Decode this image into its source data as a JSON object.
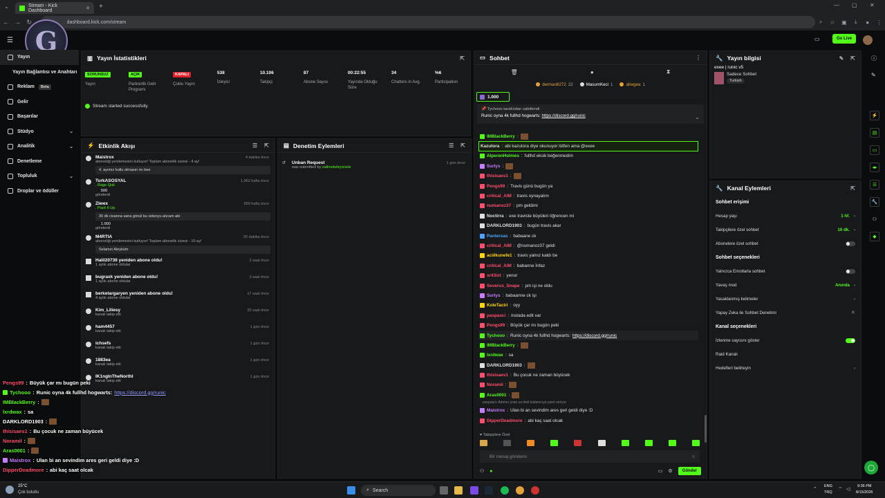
{
  "browser": {
    "tab_title": "Stream - Kick Dashboard",
    "url": "dashboard.kick.com/stream"
  },
  "header": {
    "go_live": "Go Live"
  },
  "sidebar": {
    "items": [
      {
        "label": "Yayın",
        "chev": false
      },
      {
        "label": "Yayın Bağlantısı ve Anahtarı",
        "chev": false
      },
      {
        "label": "Reklam",
        "badge": "Beta",
        "chev": false
      },
      {
        "label": "Gelir",
        "chev": false
      },
      {
        "label": "Başarılar",
        "chev": false
      },
      {
        "label": "Stüdyo",
        "chev": true
      },
      {
        "label": "Analitik",
        "chev": true
      },
      {
        "label": "Denetleme",
        "chev": false
      },
      {
        "label": "Topluluk",
        "chev": true
      },
      {
        "label": "Droplar ve ödüller",
        "chev": false
      }
    ]
  },
  "stats": {
    "title": "Yayın İstatistikleri",
    "status_msg": "Stream started successfully.",
    "items": [
      {
        "value": "SORUNSUZ",
        "label": "Yayın",
        "pill": "green"
      },
      {
        "value": "AÇIK",
        "label": "Partnerlik Gelir Programı",
        "pill": "green"
      },
      {
        "value": "KAPALI",
        "label": "Çoklu Yayın",
        "pill": "red"
      },
      {
        "value": "538",
        "label": "İzleyici"
      },
      {
        "value": "10.106",
        "label": "Takipçi"
      },
      {
        "value": "87",
        "label": "Abone Sayısı"
      },
      {
        "value": "00:22:55",
        "label": "Yayında Olduğu Süre"
      },
      {
        "value": "34",
        "label": "Chatters in Avg."
      },
      {
        "value": "%6",
        "label": "Participation"
      }
    ]
  },
  "activity": {
    "title": "Etkinlik Akışı",
    "rows": [
      {
        "name": "Maistrox",
        "desc": "aboneliği yenilemesini kutluyor! Toplam abonelik süresi - 4 ay!",
        "time": "4 dakika önce",
        "box": "4. ayımız kutlu olmasın mı bee"
      },
      {
        "name": "TurkASOSYAL",
        "desc": ". Rage Quit",
        "extra": "500",
        "extra2": "gönderdi",
        "time": "1,962 hafta önce"
      },
      {
        "name": "Ziwex",
        "desc": ". Pack It Up",
        "time": "969 hafta önce",
        "box": "30 dk civanna sana gönül bu videoyu atıcam abi",
        "extra": "1.000",
        "extra2": "gönderdi"
      },
      {
        "name": "M4RTIA",
        "desc": "aboneliği yenilemesini kutluyor! Toplam abonelik süresi - 10 ay!",
        "time": "20 dakika önce",
        "box": "Selamın Aleyküm"
      },
      {
        "name": "Halil20739 yeniden abone oldu!",
        "desc": "1 aylık abone oldular",
        "time": "2 saat önce"
      },
      {
        "name": "bugraxk yeniden abone oldu!",
        "desc": "1 aylık abone oldular",
        "time": "3 saat önce"
      },
      {
        "name": "berketargaryen yeniden abone oldu!",
        "desc": "4 aylık abone oldular",
        "time": "17 saat önce"
      },
      {
        "name": "Kim_Liliesy",
        "desc": "kanalı takip etti",
        "time": "20 saat önce"
      },
      {
        "name": "ham4457",
        "desc": "kanalı takip etti",
        "time": "1 gün önce"
      },
      {
        "name": "ichsefs",
        "desc": "kanalı takip etti",
        "time": "1 gün önce"
      },
      {
        "name": "1883ea",
        "desc": "kanalı takip etti",
        "time": "1 gün önce"
      },
      {
        "name": "IK1ngInTheNorthI",
        "desc": "kanalı takip etti",
        "time": "1 gün önce"
      }
    ]
  },
  "moderation": {
    "title": "Denetim Eylemleri",
    "rows": [
      {
        "name": "Unban Request",
        "desc": "was submitted by",
        "user": "zalimotizleyicisiiz",
        "time": "1 gün önce"
      }
    ]
  },
  "chat": {
    "title": "Sohbet",
    "top_gifters": [
      {
        "name": "derman8272",
        "count": "22"
      },
      {
        "name": "MasumKeci",
        "count": "1"
      },
      {
        "name": "aliwgea",
        "count": "1"
      }
    ],
    "kicks": "1.000",
    "pinned_by": "Tychooo tarafından sabitlendi",
    "pinned_text": "Runic oyna 4k fullhd hogwarts:",
    "pinned_link": "https://discord.gg/runic",
    "messages": [
      {
        "user": "IMBlackBerry",
        "color": "#53fc18",
        "text": "",
        "emote": true
      },
      {
        "user": "Kazutora",
        "color": "#e0e0e0",
        "text": "abi kazutora diye okunuyor lütfen ama @exee",
        "highlight": true
      },
      {
        "user": "AlperenHolmes",
        "color": "#53fc18",
        "text": "fullhd eksik beğenmedim"
      },
      {
        "user": "Surlys",
        "color": "#c77dff",
        "text": "",
        "emote": true
      },
      {
        "user": "thisisaes1",
        "color": "#ff4d6d",
        "text": "",
        "emote": true
      },
      {
        "user": "Pengs99",
        "color": "#ff4d6d",
        "text": "Travis günü bugün ya"
      },
      {
        "user": "critical_AIM",
        "color": "#ff4d6d",
        "text": "travis oynayalım"
      },
      {
        "user": "numanoz37",
        "color": "#ff4d6d",
        "text": "pm geldimi"
      },
      {
        "user": "Noctirra",
        "color": "#e0e0e0",
        "text": "exe traviste büyüleri öğrencen mi"
      },
      {
        "user": "DARKLORD1903",
        "color": "#e0e0e0",
        "text": "bugün travis akar"
      },
      {
        "user": "Pantersas",
        "color": "#4da3ff",
        "text": "babaane ck"
      },
      {
        "user": "critical_AIM",
        "color": "#ff4d6d",
        "text": "@numanoz37 geldi"
      },
      {
        "user": "aciilkunefe1",
        "color": "#ffd60a",
        "text": "travis yalnız kaldı be"
      },
      {
        "user": "critical_AIM",
        "color": "#ff4d6d",
        "text": "babanne İnfaz"
      },
      {
        "user": "sr43ist",
        "color": "#ff4d6d",
        "text": "yenur"
      },
      {
        "user": "Severus_Snape",
        "color": "#ff4d6d",
        "text": "pm işi ne oldu"
      },
      {
        "user": "Surlys",
        "color": "#c77dff",
        "text": "babaanne ck işi"
      },
      {
        "user": "KoleTaciri",
        "color": "#ffd60a",
        "text": "oyy"
      },
      {
        "user": "paspasci",
        "color": "#ff4d6d",
        "text": "instada edit var"
      },
      {
        "user": "Pengs99",
        "color": "#ff4d6d",
        "text": "Büyük çar mı bugün peki"
      },
      {
        "user": "Tychooo",
        "color": "#53fc18",
        "text": "Runic oyna 4k fullhd hogwarts:",
        "link": "https://discord.gg/runic",
        "boxed": true
      },
      {
        "user": "IMBlackBerry",
        "color": "#53fc18",
        "text": "",
        "emote": true
      },
      {
        "user": "lxrdwax",
        "color": "#53fc18",
        "text": "sa"
      },
      {
        "user": "DARKLORD1903",
        "color": "#e0e0e0",
        "text": "",
        "emote": true
      },
      {
        "user": "thisisaes1",
        "color": "#ff4d6d",
        "text": "Bu çocuk ne zaman büyücek"
      },
      {
        "user": "Noramil",
        "color": "#ff4d6d",
        "text": "",
        "emote": true
      },
      {
        "user": "Aras0001",
        "color": "#53fc18",
        "text": "",
        "emote": true
      },
      {
        "user": "Maistrox",
        "color": "#c77dff",
        "text": "Ulan bi an sevindim ares geri geldi diye :D",
        "reply": "paspasci: Adımın çnan ya timit kullanıcıya yanıt veriyor"
      },
      {
        "user": "DipperDeadmore",
        "color": "#ff4d6d",
        "text": "abi kaç saat olcak"
      }
    ],
    "followers_only": "Takipçilere Özel",
    "input_placeholder": "Bir mesaj gönderin",
    "send": "Gönder"
  },
  "stream_info": {
    "title": "Yayın bilgisi",
    "stream_title": "exee | runic v5",
    "category": "Sadece Sohbet",
    "tag": "Turkish"
  },
  "channel_actions": {
    "title": "Kanal Eylemleri",
    "sections": [
      {
        "heading": "Sohbet erişimi",
        "rows": [
          {
            "label": "Hesap yaşı",
            "value": "1 hf.",
            "chev": true
          },
          {
            "label": "Takipçilere özel sohbet",
            "value": "10 dk.",
            "chev": true
          },
          {
            "label": "Abonelere özel sohbet",
            "toggle": "off"
          }
        ]
      },
      {
        "heading": "Sohbet seçenekleri",
        "rows": [
          {
            "label": "Yalnızca Emotlarla sohbet",
            "toggle": "off"
          },
          {
            "label": "Yavaş mod",
            "value": "Anında",
            "chev": true
          },
          {
            "label": "Yasaklanmış kelimeler",
            "chev": true
          },
          {
            "label": "Yapay Zeka ile Sohbet Denetimi",
            "ext": true
          }
        ]
      },
      {
        "heading": "Kanal seçenekleri",
        "rows": [
          {
            "label": "İzlenme sayısını göster",
            "toggle": "on"
          },
          {
            "label": "Raid Kanalı"
          },
          {
            "label": "Hedefleri belirleyin",
            "chev": true
          }
        ]
      }
    ]
  },
  "overlay_chat": [
    {
      "user": "Pengs99",
      "color": "#ff4d6d",
      "text": "Büyük çar mı bugün peki"
    },
    {
      "user": "Tychooo",
      "color": "#53fc18",
      "text": "Runic oyna 4k fullhd hogwarts:",
      "link": "https://discord.gg/runic"
    },
    {
      "user": "IMBlackBerry",
      "color": "#53fc18",
      "text": "",
      "emote": true
    },
    {
      "user": "lxrdwax",
      "color": "#53fc18",
      "text": "sa"
    },
    {
      "user": "DARKLORD1903",
      "color": "#ffffff",
      "text": "",
      "emote": true
    },
    {
      "user": "thisisaes1",
      "color": "#ff4d6d",
      "text": "Bu çocuk ne zaman büyücek"
    },
    {
      "user": "Noramil",
      "color": "#ff4d6d",
      "text": "",
      "emote": true
    },
    {
      "user": "Aras0001",
      "color": "#53fc18",
      "text": "",
      "emote": true
    },
    {
      "user": "Maistrox",
      "color": "#c77dff",
      "text": "Ulan bi an sevindim ares geri geldi diye :D"
    },
    {
      "user": "DipperDeadmore",
      "color": "#ff4d6d",
      "text": "abi kaç saat olcak"
    }
  ],
  "taskbar": {
    "weather_temp": "25°C",
    "weather_desc": "Çok bulutlu",
    "search": "Search",
    "lang1": "ENG",
    "lang2": "TRQ",
    "time": "9:36 PM",
    "date": "8/15/2026"
  }
}
